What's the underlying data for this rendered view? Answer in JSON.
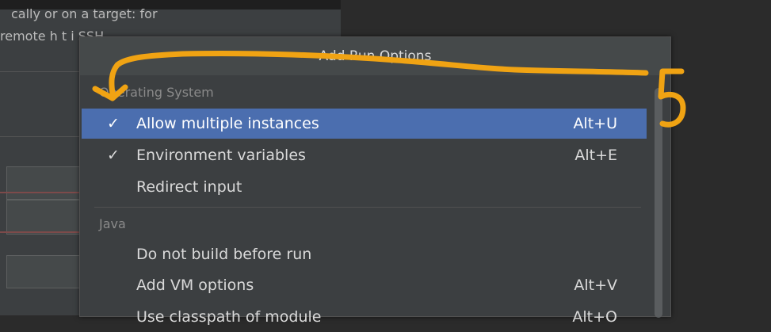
{
  "background_window": {
    "line1": "cally or on a target: for",
    "line2": "remote h    t    i    SSH"
  },
  "popup": {
    "title": "Add Run Options",
    "groups": [
      {
        "label": "Operating System",
        "items": [
          {
            "label": "Allow multiple instances",
            "shortcut": "Alt+U",
            "checked": true,
            "selected": true
          },
          {
            "label": "Environment variables",
            "shortcut": "Alt+E",
            "checked": true,
            "selected": false
          },
          {
            "label": "Redirect input",
            "shortcut": "",
            "checked": false,
            "selected": false
          }
        ]
      },
      {
        "label": "Java",
        "items": [
          {
            "label": "Do not build before run",
            "shortcut": "",
            "checked": false,
            "selected": false
          },
          {
            "label": "Add VM options",
            "shortcut": "Alt+V",
            "checked": false,
            "selected": false
          },
          {
            "label": "Use classpath of module",
            "shortcut": "Alt+O",
            "checked": false,
            "selected": false
          }
        ]
      }
    ],
    "check_glyph": "✓"
  },
  "annotation": {
    "number": "5",
    "color": "#f0a313"
  }
}
